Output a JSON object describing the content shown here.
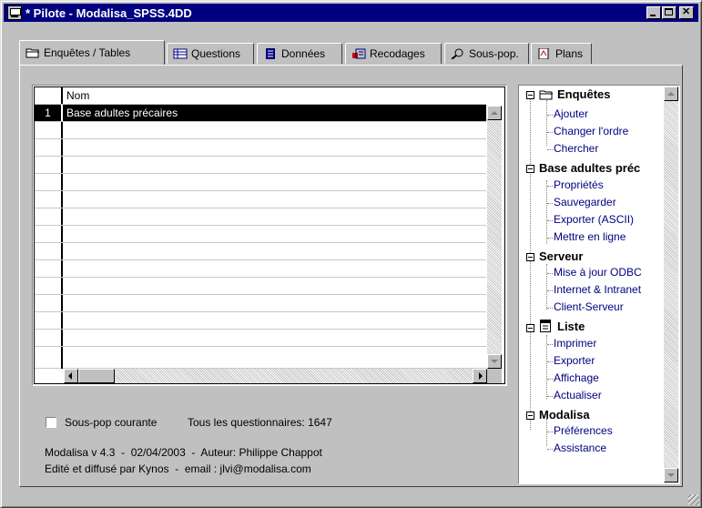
{
  "window": {
    "title": "* Pilote - Modalisa_SPSS.4DD"
  },
  "tabs": [
    {
      "label": "Enquêtes / Tables",
      "icon": "folder-icon",
      "active": true
    },
    {
      "label": "Questions",
      "icon": "table-icon",
      "active": false
    },
    {
      "label": "Données",
      "icon": "data-book-icon",
      "active": false
    },
    {
      "label": "Recodages",
      "icon": "recode-icon",
      "active": false
    },
    {
      "label": "Sous-pop.",
      "icon": "magnifier-icon",
      "active": false
    },
    {
      "label": "Plans",
      "icon": "plan-icon",
      "active": false
    }
  ],
  "grid": {
    "column_header": "Nom",
    "rows": [
      {
        "num": "1",
        "name": "Base adultes précaires",
        "selected": true
      }
    ]
  },
  "status": {
    "checkbox_label": "Sous-pop courante",
    "count_text": "Tous les questionnaires: 1647",
    "version_line": "Modalisa v 4.3  -  02/04/2003  -  Auteur: Philippe Chappot",
    "publisher_line": "Edité et diffusé par Kynos  -  email : jlvi@modalisa.com"
  },
  "tree": [
    {
      "label": "Enquêtes",
      "icon": "folder-icon",
      "children": [
        "Ajouter",
        "Changer l'ordre",
        "Chercher"
      ]
    },
    {
      "label": "Base adultes préc",
      "icon": "",
      "children": [
        "Propriétés",
        "Sauvegarder",
        "Exporter (ASCII)",
        "Mettre en ligne"
      ]
    },
    {
      "label": "Serveur",
      "icon": "",
      "children": [
        "Mise à jour ODBC",
        "Internet & Intranet",
        "Client-Serveur"
      ]
    },
    {
      "label": "Liste",
      "icon": "list-icon",
      "children": [
        "Imprimer",
        "Exporter",
        "Affichage",
        "Actualiser"
      ]
    },
    {
      "label": "Modalisa",
      "icon": "",
      "children": [
        "Préférences",
        "Assistance"
      ]
    }
  ]
}
